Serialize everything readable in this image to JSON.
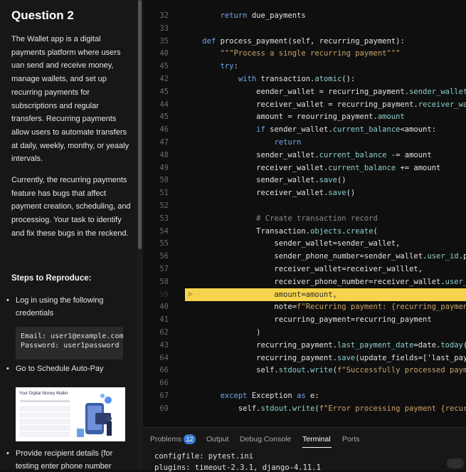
{
  "question": {
    "title": "Question 2",
    "paragraphs": [
      "The Wallet app is a digital payments platform where users uan send and receive money, manage wallets, and set up recurring payments for subscriptions and regular transfers. Recurring payments allow users to automate transfers at daily, weekly, monthy, or yeaaly intervals.",
      "Currently, the recurring payments feature has bugs that affect payment creation, scheduling, and processiog. Your task to identify and fix these bugs in the reckend."
    ],
    "steps_heading": "Steps to Reproduce:",
    "steps": [
      "Log in using the following credentials",
      "Go to Schedule Auto-Pay",
      "Provide recipient details (for testing enter phone number"
    ],
    "credentials": {
      "email_line": "Email:  user1@example.com",
      "password_line": "Password:  user1password"
    },
    "thumbnail": {
      "title": "Your Digital Money Wallet"
    }
  },
  "editor": {
    "highlight_color": "#f4d44d",
    "lines": [
      {
        "n": "32",
        "code": "        return due_payments"
      },
      {
        "n": "33",
        "code": ""
      },
      {
        "n": "35",
        "code": "    def process_payment(self, recurring_payment):"
      },
      {
        "n": "40",
        "code": "        \"\"\"Process a single recurring payment\"\"\""
      },
      {
        "n": "45",
        "code": "        try:"
      },
      {
        "n": "42",
        "code": "            with transaction.atomic():"
      },
      {
        "n": "45",
        "code": "                eender_wallet = recurring_payment.sender_wallet"
      },
      {
        "n": "44",
        "code": "                receiver_wallet = recurring_payment.receiver_wallet"
      },
      {
        "n": "45",
        "code": "                amount = reourring_payment.amount"
      },
      {
        "n": "46",
        "code": "                if sender_wallet.current_balance<amount:"
      },
      {
        "n": "47",
        "code": "                    return"
      },
      {
        "n": "48",
        "code": "                sender_wallet.current_balance -= amount"
      },
      {
        "n": "49",
        "code": "                receiver_wallet.current_balance += amount"
      },
      {
        "n": "50",
        "code": "                sender_wallet.save()"
      },
      {
        "n": "51",
        "code": "                receiver_wallet.save()"
      },
      {
        "n": "52",
        "code": ""
      },
      {
        "n": "53",
        "code": "                # Create transaction record"
      },
      {
        "n": "54",
        "code": "                Transaction.objects.create("
      },
      {
        "n": "55",
        "code": "                    sender_wallet=sender_wallet,"
      },
      {
        "n": "56",
        "code": "                    sender_phone_number=sender_wallet.user_id.phone"
      },
      {
        "n": "57",
        "code": "                    receiver_wallet=receiver_walllet,"
      },
      {
        "n": "58",
        "code": "                    receiver_phone_number=receiver_wallet.user_id"
      },
      {
        "n": "59",
        "code": "                    amount=amount,"
      },
      {
        "n": "40",
        "code": "                    note=f\"Recurring payment: {recurring_payment}\""
      },
      {
        "n": "41",
        "code": "                    recurring_payment=recurring_payment"
      },
      {
        "n": "62",
        "code": "                )"
      },
      {
        "n": "43",
        "code": "                recurring_payment.last_payment_date=date.today()"
      },
      {
        "n": "64",
        "code": "                recurring_payment.save(update_fields=['last_payment"
      },
      {
        "n": "66",
        "code": "                self.stdout.write(f\"Successfully processed payment"
      },
      {
        "n": "66",
        "code": ""
      },
      {
        "n": "67",
        "code": "        except Exception as e:"
      },
      {
        "n": "69",
        "code": "            self.stdout.write(f\"Error processing payment {recurring"
      }
    ]
  },
  "panel": {
    "tabs": [
      "Problems",
      "Output",
      "Debug Console",
      "Terminal",
      "Ports"
    ],
    "active_tab": "Terminal",
    "problems_count": "12",
    "terminal_lines": [
      "configfile: pytest.ini",
      "plugins: timeout-2.3.1, django-4.11.1"
    ]
  }
}
